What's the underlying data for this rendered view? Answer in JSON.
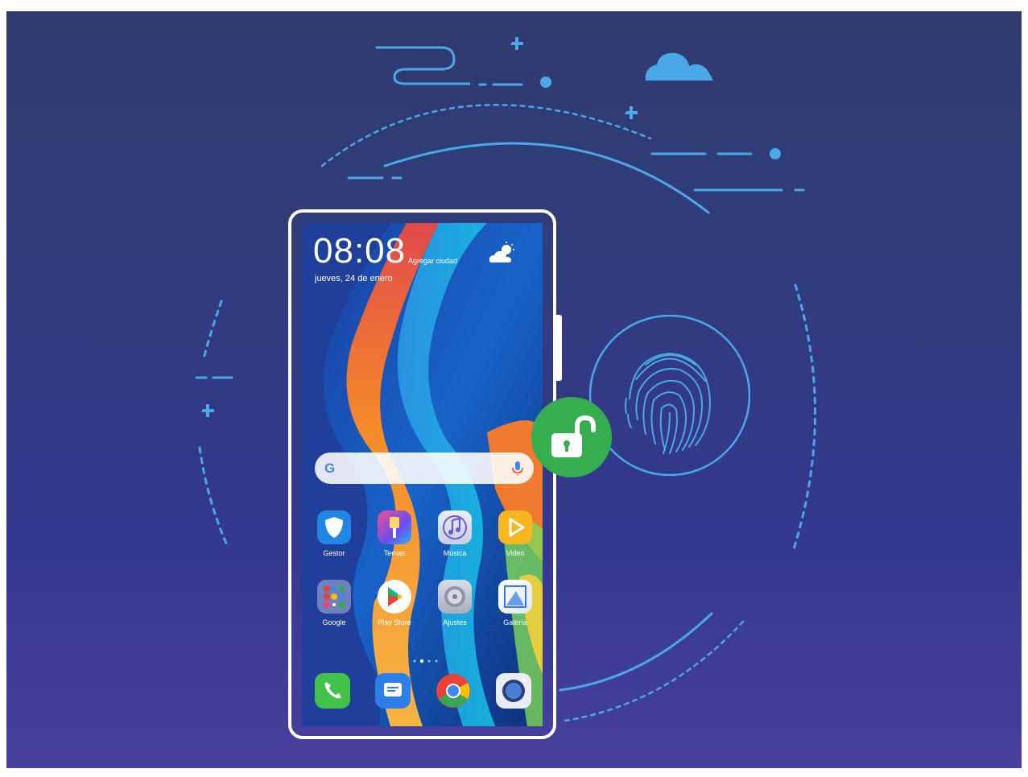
{
  "phone": {
    "clock": "08:08",
    "city": "Agregar ciudad",
    "date": "jueves, 24 de enero",
    "weather_icon": "partly-cloudy-icon",
    "search": {
      "logo": "G",
      "mic_icon": "microphone-icon"
    },
    "apps_row1": [
      {
        "label": "Gestor",
        "icon": "shield-icon"
      },
      {
        "label": "Temas",
        "icon": "brush-icon"
      },
      {
        "label": "Música",
        "icon": "music-note-icon"
      },
      {
        "label": "Video",
        "icon": "play-icon"
      }
    ],
    "apps_row2": [
      {
        "label": "Google",
        "icon": "google-folder-icon"
      },
      {
        "label": "Play Store",
        "icon": "play-store-icon"
      },
      {
        "label": "Ajustes",
        "icon": "settings-gear-icon"
      },
      {
        "label": "Galería",
        "icon": "gallery-icon"
      }
    ],
    "dock": [
      {
        "icon": "phone-call-icon"
      },
      {
        "icon": "messages-icon"
      },
      {
        "icon": "chrome-icon"
      },
      {
        "icon": "camera-icon"
      }
    ]
  },
  "overlay": {
    "unlock_icon": "unlocked-padlock-icon",
    "fingerprint_icon": "fingerprint-icon"
  },
  "colors": {
    "accent": "#4aa8e8",
    "unlock": "#36ad4e",
    "bg_top": "#2f3b6e",
    "bg_bottom": "#483f9e"
  }
}
